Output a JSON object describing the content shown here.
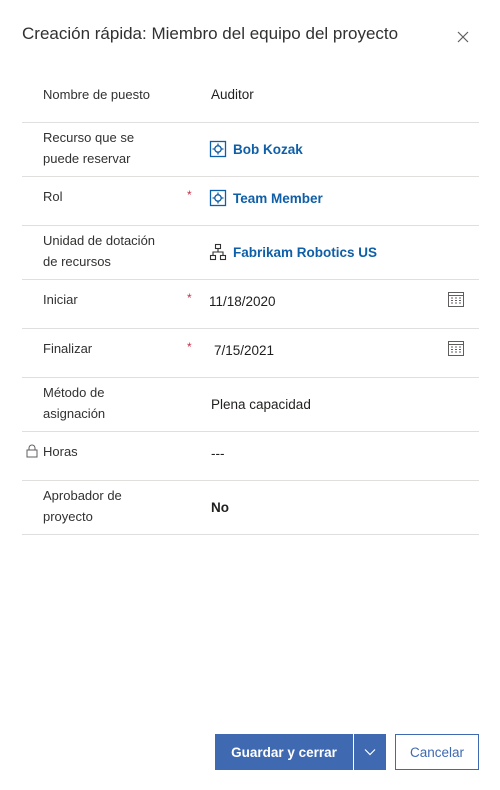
{
  "dialog": {
    "title": "Creación rápida: Miembro del equipo del proyecto"
  },
  "fields": {
    "job_title": {
      "label": "Nombre de puesto",
      "value": "Auditor"
    },
    "bookable_resource": {
      "label_line1": "Recurso que se",
      "label_line2": "puede reservar",
      "value": "Bob Kozak",
      "icon": "bookable-resource-icon"
    },
    "role": {
      "label": "Rol",
      "required_mark": "*",
      "value": "Team Member",
      "icon": "role-icon"
    },
    "resourcing_unit": {
      "label_line1": "Unidad de dotación",
      "label_line2": "de recursos",
      "value": "Fabrikam Robotics US",
      "icon": "org-unit-icon"
    },
    "start": {
      "label": "Iniciar",
      "required_mark": "*",
      "value": "11/18/2020",
      "icon": "calendar-icon"
    },
    "finish": {
      "label": "Finalizar",
      "required_mark": "*",
      "value": "7/15/2021",
      "icon": "calendar-icon"
    },
    "allocation_method": {
      "label_line1": "Método de",
      "label_line2": "asignación",
      "value": "Plena capacidad"
    },
    "hours": {
      "label": "Horas",
      "value": "---",
      "icon": "lock-icon"
    },
    "project_approver": {
      "label_line1": "Aprobador de",
      "label_line2": "proyecto",
      "value": "No"
    }
  },
  "footer": {
    "save_close_label": "Guardar y cerrar",
    "cancel_label": "Cancelar"
  },
  "colors": {
    "primary": "#3f6ab1",
    "link": "#0f5fa8",
    "required": "#c4314b",
    "divider": "#e1dfdd"
  }
}
